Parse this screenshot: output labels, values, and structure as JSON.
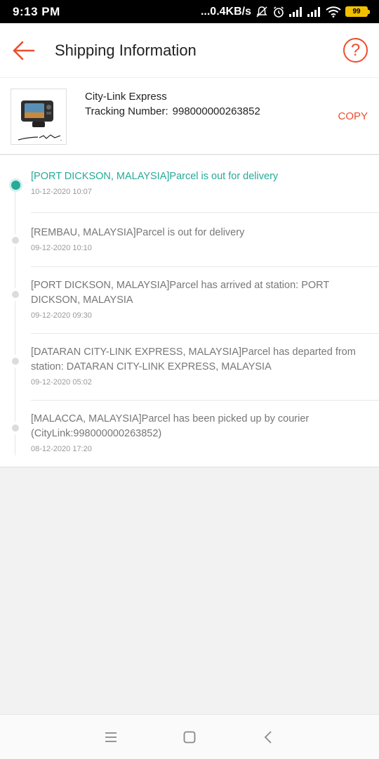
{
  "status_bar": {
    "time": "9:13 PM",
    "network_speed": "...0.4KB/s",
    "battery_level": "99",
    "icons": [
      "mute-icon",
      "alarm-icon",
      "signal-icon",
      "signal-icon",
      "wifi-icon",
      "battery-icon"
    ]
  },
  "header": {
    "title": "Shipping Information",
    "help_icon": "question-circle-icon",
    "back_icon": "arrow-left-icon"
  },
  "shipment": {
    "carrier": "City-Link Express",
    "tracking_label": "Tracking Number:",
    "tracking_number": "998000000263852",
    "copy_label": "COPY"
  },
  "events": [
    {
      "message": "[PORT DICKSON, MALAYSIA]Parcel is out for delivery",
      "time": "10-12-2020 10:07",
      "active": true
    },
    {
      "message": "[REMBAU, MALAYSIA]Parcel is out for delivery",
      "time": "09-12-2020 10:10",
      "active": false
    },
    {
      "message": "[PORT DICKSON, MALAYSIA]Parcel has arrived at station: PORT DICKSON, MALAYSIA",
      "time": "09-12-2020 09:30",
      "active": false
    },
    {
      "message": "[DATARAN CITY-LINK EXPRESS, MALAYSIA]Parcel has departed from station: DATARAN CITY-LINK EXPRESS, MALAYSIA",
      "time": "09-12-2020 05:02",
      "active": false
    },
    {
      "message": "[MALACCA, MALAYSIA]Parcel has been picked up by courier (CityLink:998000000263852)",
      "time": "08-12-2020 17:20",
      "active": false
    }
  ],
  "colors": {
    "accent": "#ee4d2d",
    "active_status": "#26aa99",
    "inactive_dot": "#dcdcdc"
  },
  "nav": {
    "icons": [
      "menu-icon",
      "home-square-icon",
      "back-chevron-icon"
    ]
  }
}
